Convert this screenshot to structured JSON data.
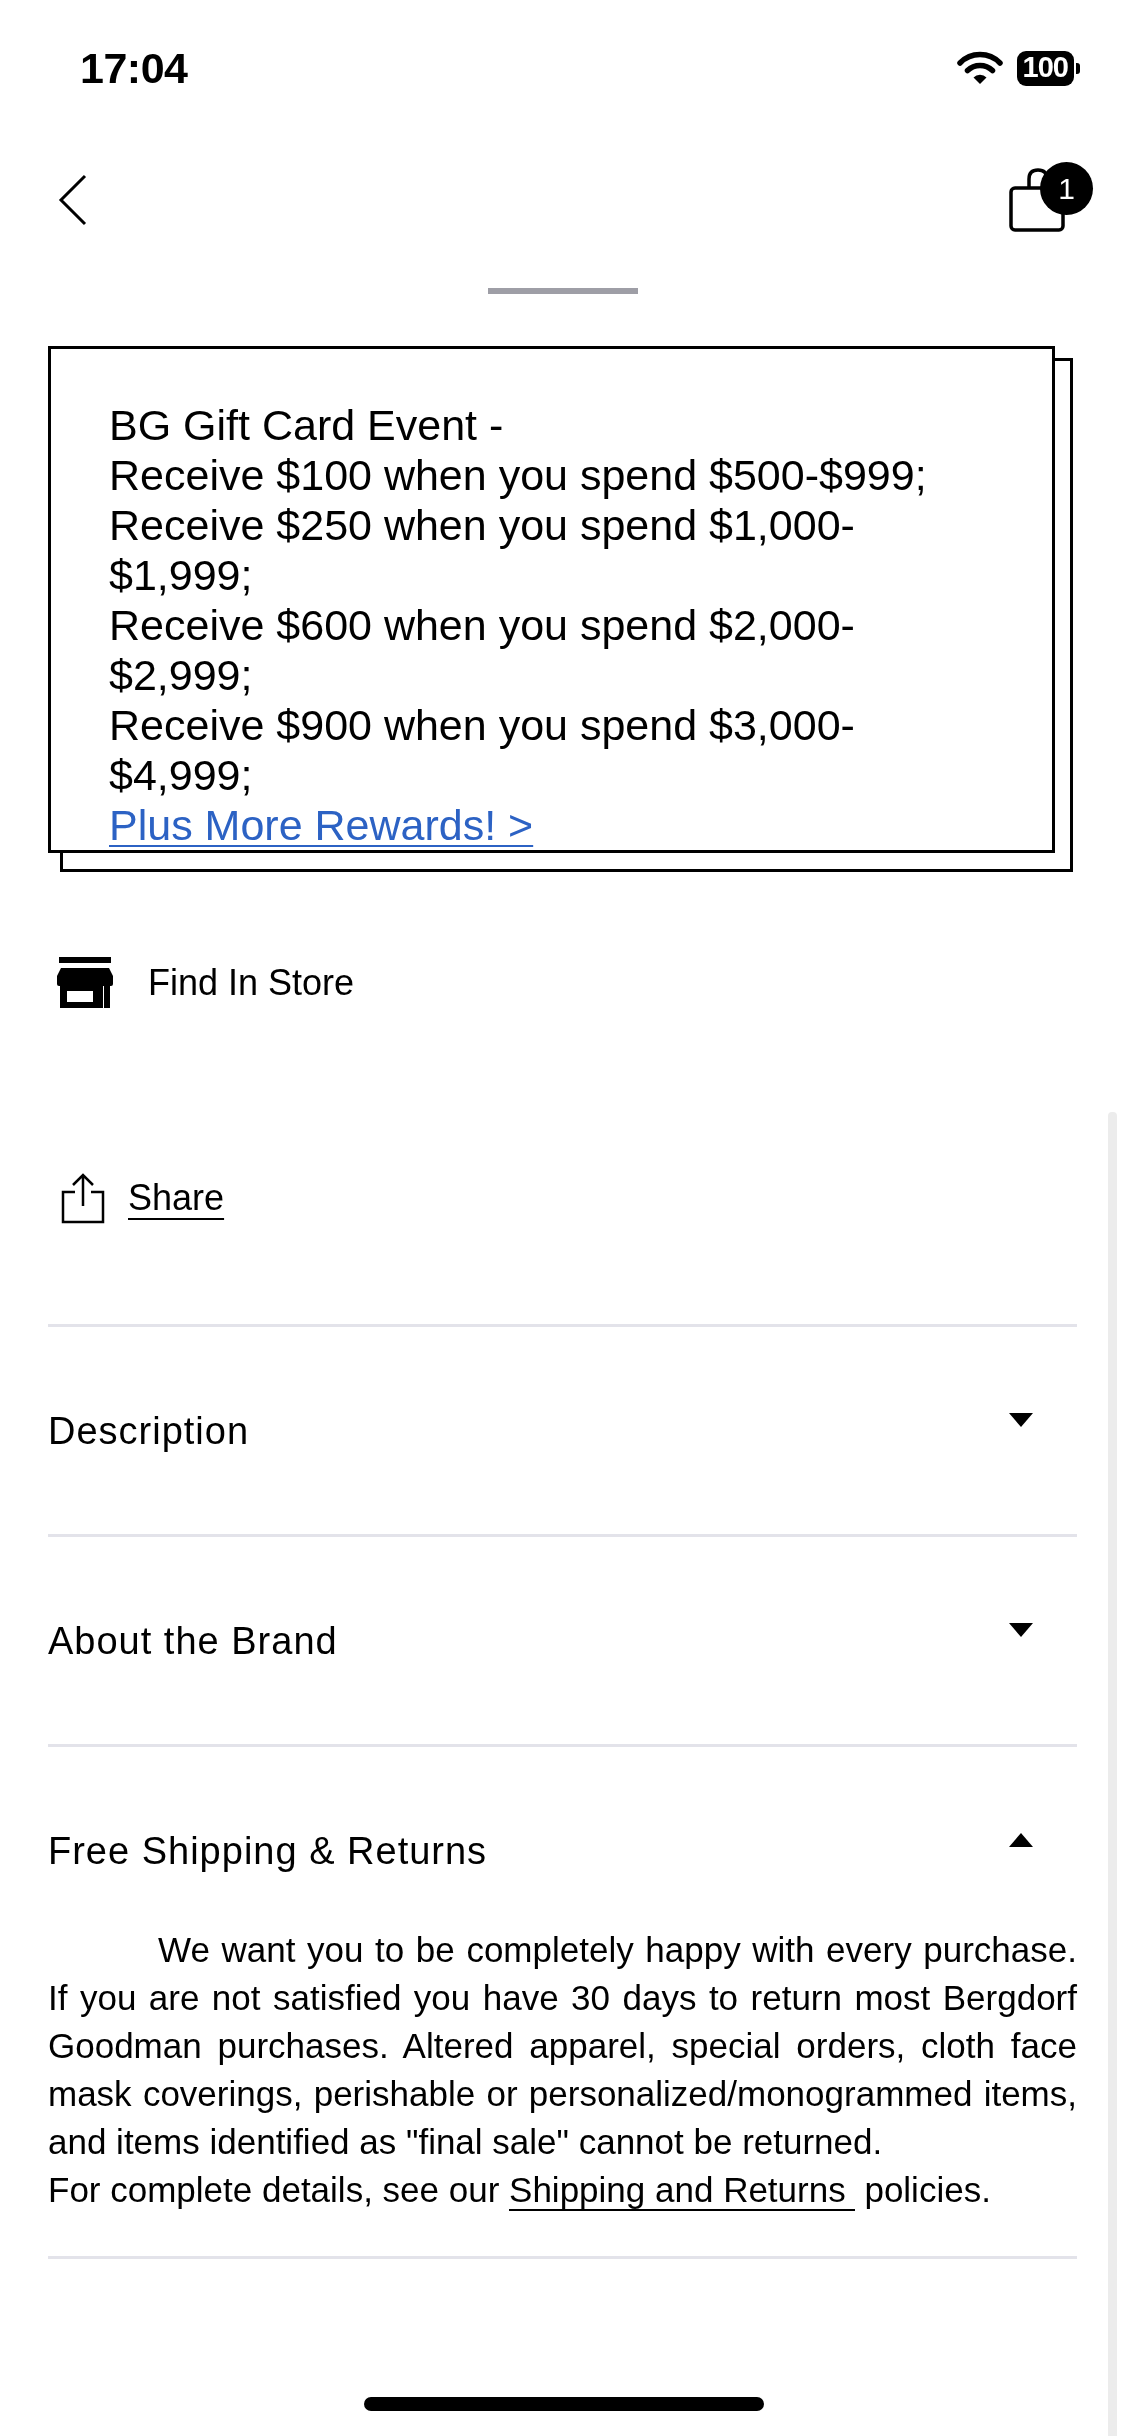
{
  "status_bar": {
    "time": "17:04",
    "battery": "100"
  },
  "header": {
    "cart_count": "1"
  },
  "promo": {
    "title": "BG Gift Card Event -",
    "offers": [
      "Receive $100 when you spend $500-$999;",
      "Receive $250 when you spend $1,000-$1,999;",
      "Receive $600 when you spend $2,000-$2,999;",
      "Receive $900 when you spend $3,000-$4,999;"
    ],
    "link": "Plus More Rewards! >"
  },
  "actions": [
    {
      "kind": "store",
      "label": "Find In Store"
    },
    {
      "kind": "share",
      "label": "Share"
    }
  ],
  "sections": [
    {
      "title": "Description",
      "expanded": false
    },
    {
      "title": "About the Brand",
      "expanded": false
    },
    {
      "title": "Free Shipping & Returns",
      "expanded": true,
      "body": {
        "text": "We want you to be completely happy with every purchase. If you are not satisfied you have 30 days to return most Bergdorf Goodman purchases. Altered apparel, special orders, cloth face mask coverings, perishable or personalized/monogrammed items, and items identified as \"final sale\" cannot be returned.",
        "details_before": "For complete details, see our",
        "details_link": "Shipping and Returns",
        "details_after": "policies."
      }
    }
  ]
}
